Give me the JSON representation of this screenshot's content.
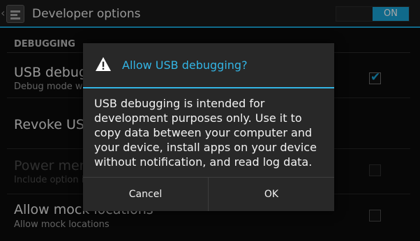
{
  "action_bar": {
    "title": "Developer options",
    "master_switch": "ON",
    "up_icon": "chevron-left-icon",
    "app_icon": "settings-sliders-icon",
    "accent_color": "#1aa3d6"
  },
  "list": {
    "section_header": "DEBUGGING",
    "items": [
      {
        "title": "USB debugging",
        "summary": "Debug mode when USB is connected",
        "checked": true
      },
      {
        "title": "Revoke USB debugging authorizations"
      },
      {
        "title": "Power menu bug reports",
        "summary": "Include option in power menu for taking a bug report",
        "checked": false,
        "disabled": true
      },
      {
        "title": "Allow mock locations",
        "summary": "Allow mock locations",
        "checked": false
      }
    ]
  },
  "dialog": {
    "icon": "warning-icon",
    "title": "Allow USB debugging?",
    "message": "USB debugging is intended for development purposes only. Use it to copy data between your computer and your device, install apps on your device without notification, and read log data.",
    "cancel_label": "Cancel",
    "ok_label": "OK",
    "title_color": "#33b5e5"
  }
}
